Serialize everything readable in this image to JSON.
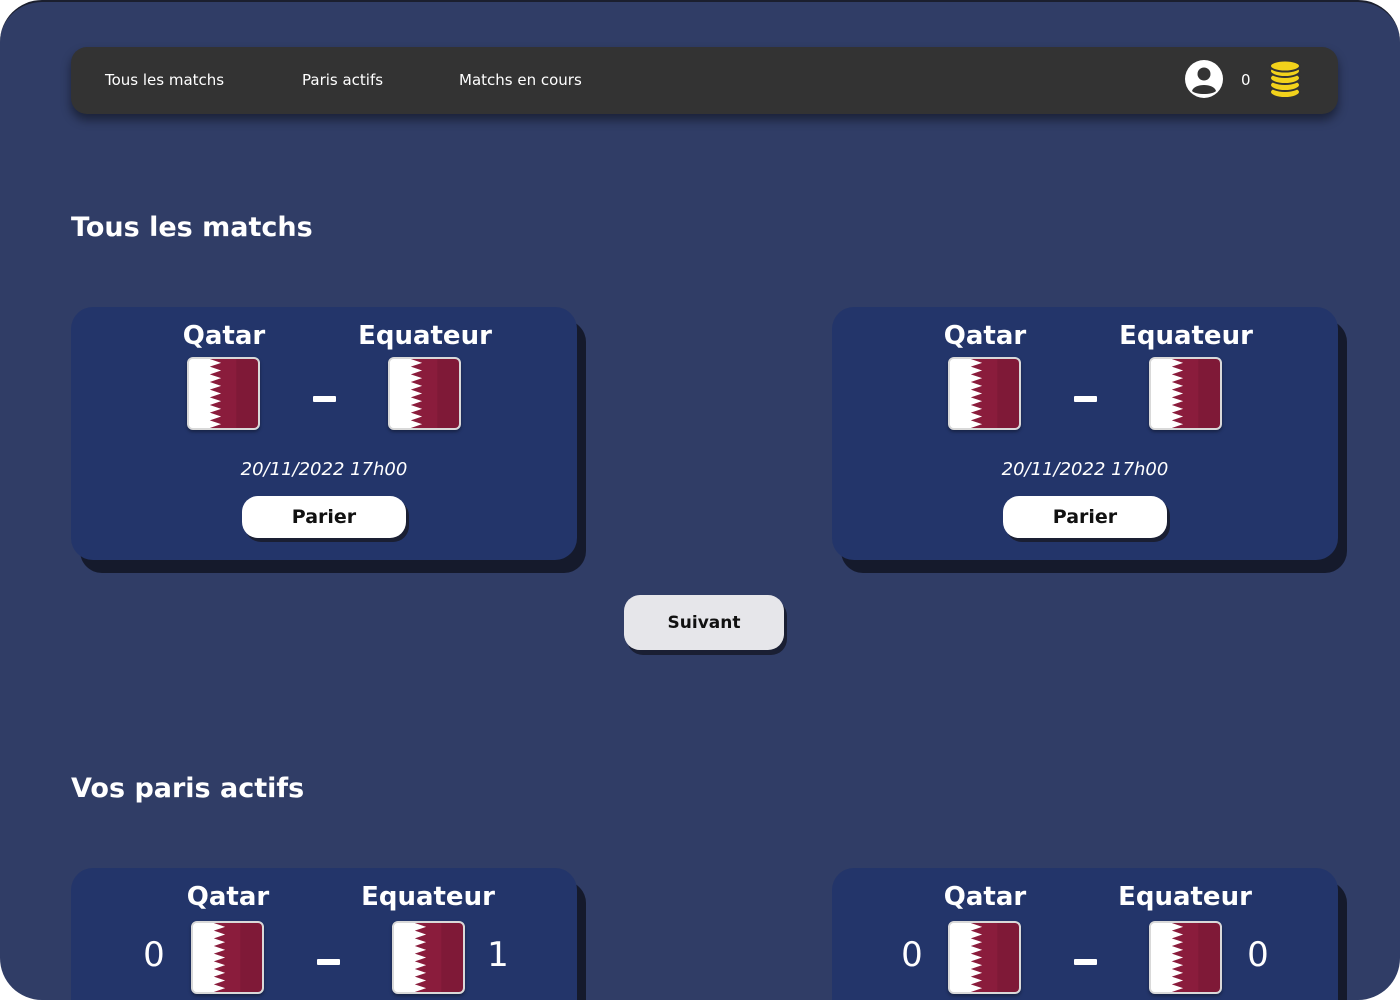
{
  "nav": {
    "links": [
      "Tous les matchs",
      "Paris actifs",
      "Matchs en cours"
    ],
    "balance": "0",
    "icons": {
      "user": "user-circle-icon",
      "coins": "coins-stack-icon"
    },
    "coin_color": "#f2d21b"
  },
  "sections": {
    "all_matches_title": "Tous les matchs",
    "active_bets_title": "Vos paris actifs"
  },
  "matches": [
    {
      "home": "Qatar",
      "away": "Equateur",
      "date": "20/11/2022 17h00",
      "button": "Parier"
    },
    {
      "home": "Qatar",
      "away": "Equateur",
      "date": "20/11/2022 17h00",
      "button": "Parier"
    }
  ],
  "next_button": "Suivant",
  "active_bets": [
    {
      "home": "Qatar",
      "away": "Equateur",
      "home_score": "0",
      "away_score": "1"
    },
    {
      "home": "Qatar",
      "away": "Equateur",
      "home_score": "0",
      "away_score": "0"
    }
  ],
  "colors": {
    "background": "#303d66",
    "card": "#23356a",
    "navbar": "#333333",
    "flag_maroon": "#8a1c3c"
  }
}
